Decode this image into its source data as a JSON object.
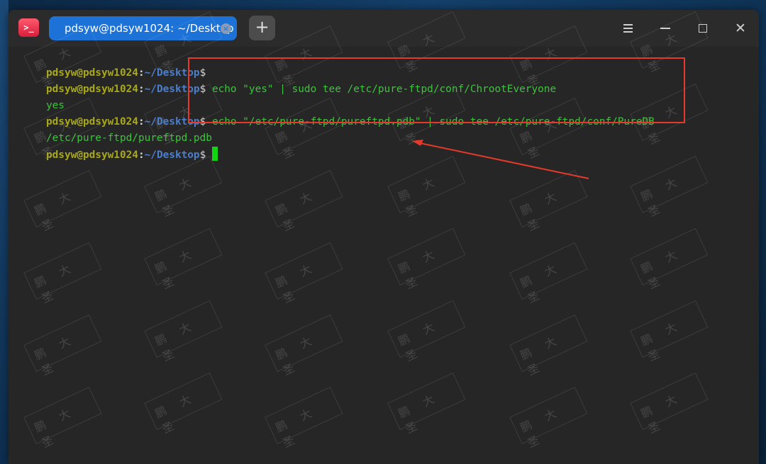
{
  "window": {
    "app_icon": "terminal-icon",
    "tab_title": "pdsyw@pdsyw1024: ~/Desktop",
    "tab_close_glyph": "×",
    "new_tab_glyph": "+",
    "menu_icon": "hamburger-menu-icon",
    "minimize_icon": "minimize-icon",
    "maximize_icon": "maximize-icon",
    "close_icon": "close-icon",
    "close_glyph": "✕"
  },
  "terminal": {
    "prompt": {
      "user": "pdsyw@pdsyw1024",
      "colon": ":",
      "path": "~/Desktop",
      "dollar": "$"
    },
    "lines": [
      {
        "type": "prompt",
        "command": ""
      },
      {
        "type": "prompt",
        "command": " echo \"yes\" | sudo tee /etc/pure-ftpd/conf/ChrootEveryone"
      },
      {
        "type": "output",
        "text": "yes"
      },
      {
        "type": "prompt",
        "command": " echo \"/etc/pure-ftpd/pureftpd.pdb\" | sudo tee /etc/pure-ftpd/conf/PureDB"
      },
      {
        "type": "output",
        "text": "/etc/pure-ftpd/pureftpd.pdb"
      },
      {
        "type": "prompt",
        "command": " "
      }
    ]
  },
  "watermark": {
    "text": "鹏 大 圣"
  },
  "colors": {
    "terminal_bg": "#262626",
    "prompt_user": "#a8a81c",
    "prompt_path": "#4d7ec9",
    "command_text": "#3fc23f",
    "cursor": "#12d412",
    "annotation": "#e53a2a",
    "tab_active": "#1d72d8"
  }
}
